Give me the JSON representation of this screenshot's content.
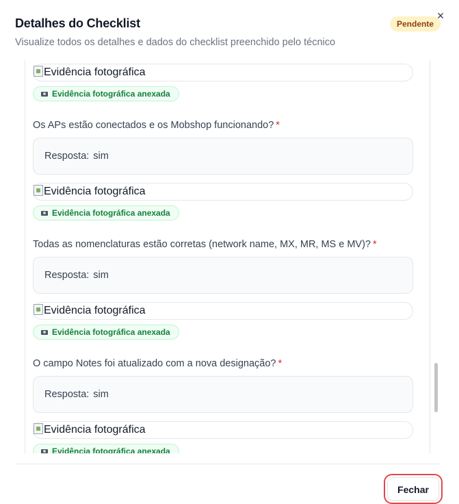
{
  "header": {
    "title": "Detalhes do Checklist",
    "subtitle": "Visualize todos os detalhes e dados do checklist preenchido pelo técnico",
    "status": "Pendente",
    "close_symbol": "×"
  },
  "colors": {
    "status_bg": "#fef3c7",
    "status_text": "#92400e",
    "evidence_bg": "#f0fdf4",
    "evidence_text": "#15803d",
    "required_mark": "#dc2626",
    "focus_ring": "#e0484b"
  },
  "checklist": {
    "photo_alt": "Evidência fotográfica",
    "evidence_label": "Evidência fotográfica anexada",
    "answer_prefix": "Resposta:",
    "required_mark": "*",
    "items": [
      {
        "question": "Os APs estão conectados e os Mobshop funcionando?",
        "answer": "sim"
      },
      {
        "question": "Todas as nomenclaturas estão corretas (network name, MX, MR, MS e MV)?",
        "answer": "sim"
      },
      {
        "question": "O campo Notes foi atualizado com a nova designação?",
        "answer": "sim"
      }
    ]
  },
  "footer": {
    "close_label": "Fechar"
  }
}
